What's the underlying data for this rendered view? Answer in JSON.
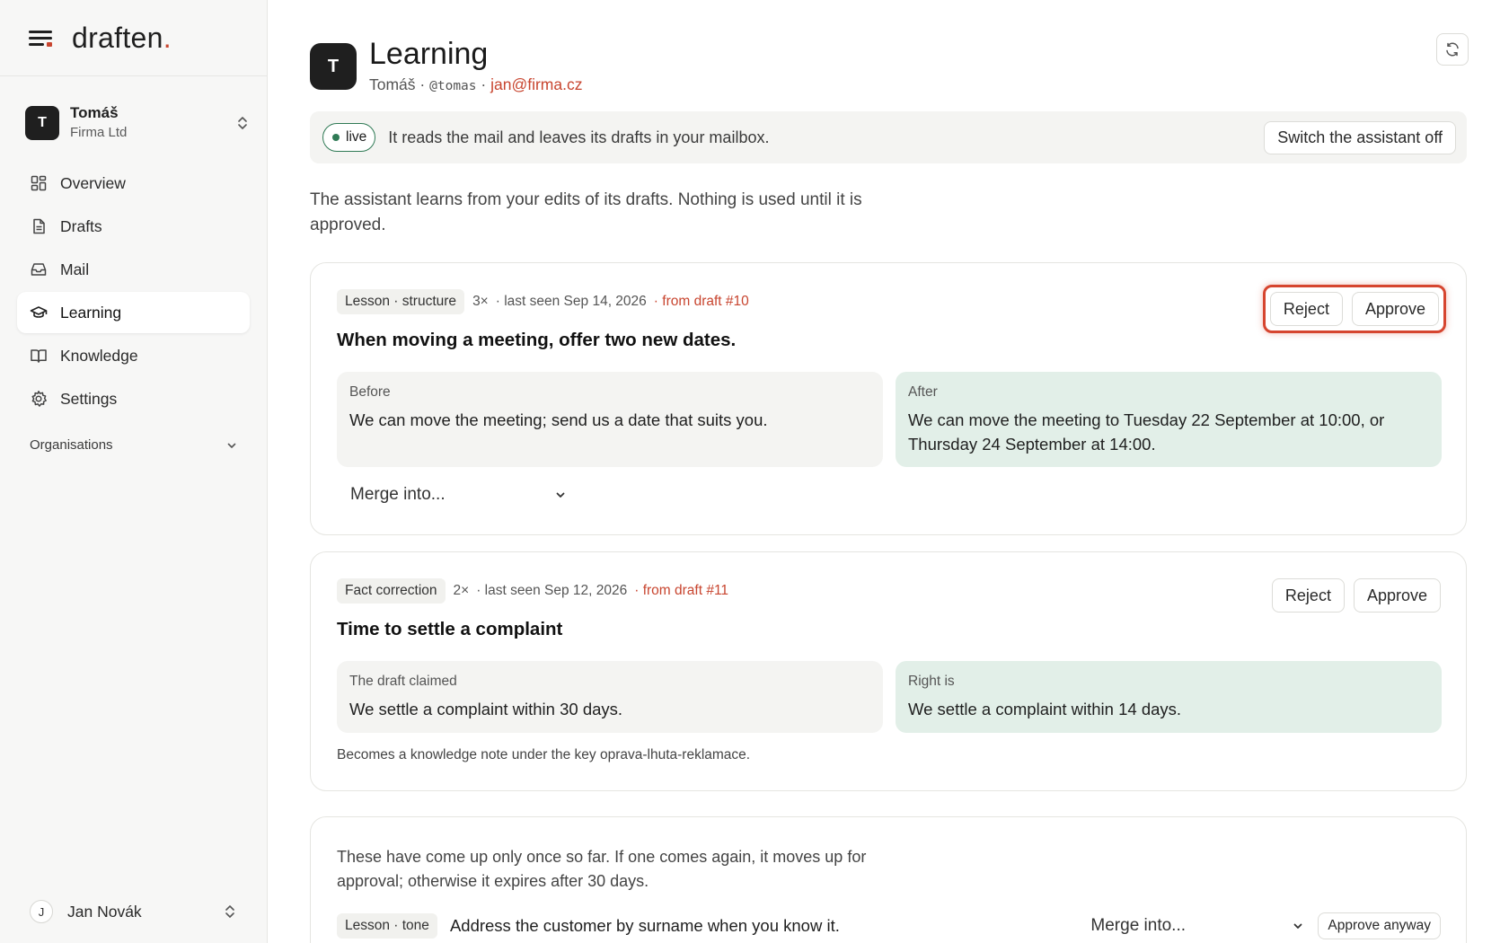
{
  "brand": {
    "name": "draften",
    "dot": "."
  },
  "account": {
    "initial": "T",
    "name": "Tomáš",
    "org": "Firma Ltd"
  },
  "nav": [
    {
      "label": "Overview",
      "icon": "overview-icon"
    },
    {
      "label": "Drafts",
      "icon": "drafts-icon"
    },
    {
      "label": "Mail",
      "icon": "mail-icon"
    },
    {
      "label": "Learning",
      "icon": "learning-icon",
      "active": true
    },
    {
      "label": "Knowledge",
      "icon": "knowledge-icon"
    },
    {
      "label": "Settings",
      "icon": "settings-icon"
    }
  ],
  "orgs_label": "Organisations",
  "user": {
    "initial": "J",
    "name": "Jan Novák"
  },
  "header": {
    "initial": "T",
    "title": "Learning",
    "name": "Tomáš",
    "sep": "·",
    "handle": "@tomas",
    "email": "jan@firma.cz"
  },
  "banner": {
    "status": "live",
    "text": "It reads the mail and leaves its drafts in your mailbox.",
    "button": "Switch the assistant off"
  },
  "intro": "The assistant learns from your edits of its drafts. Nothing is used until it is approved.",
  "cards": [
    {
      "tag": "Lesson · structure",
      "count": "3×",
      "seen": "· last seen Sep 14, 2026",
      "draft": "· from draft #10",
      "reject": "Reject",
      "approve": "Approve",
      "title": "When moving a meeting, offer two new dates.",
      "left_label": "Before",
      "left_text": "We can move the meeting; send us a date that suits you.",
      "right_label": "After",
      "right_text": "We can move the meeting to Tuesday 22 September at 10:00, or Thursday 24 September at 14:00.",
      "merge": "Merge into..."
    },
    {
      "tag": "Fact correction",
      "count": "2×",
      "seen": "· last seen Sep 12, 2026",
      "draft": "· from draft #11",
      "reject": "Reject",
      "approve": "Approve",
      "title": "Time to settle a complaint",
      "left_label": "The draft claimed",
      "left_text": "We settle a complaint within 30 days.",
      "right_label": "Right is",
      "right_text": "We settle a complaint within 14 days.",
      "note": "Becomes a knowledge note under the key oprava-lhuta-reklamace."
    }
  ],
  "pending": {
    "intro": "These have come up only once so far. If one comes again, it moves up for approval; otherwise it expires after 30 days.",
    "tag": "Lesson · tone",
    "text": "Address the customer by surname when you know it.",
    "merge": "Merge into...",
    "approve_anyway": "Approve anyway"
  },
  "colors": {
    "accent": "#c8452f",
    "live": "#2f7a55",
    "after_bg": "#e2efe8",
    "highlight": "#d6452f"
  }
}
